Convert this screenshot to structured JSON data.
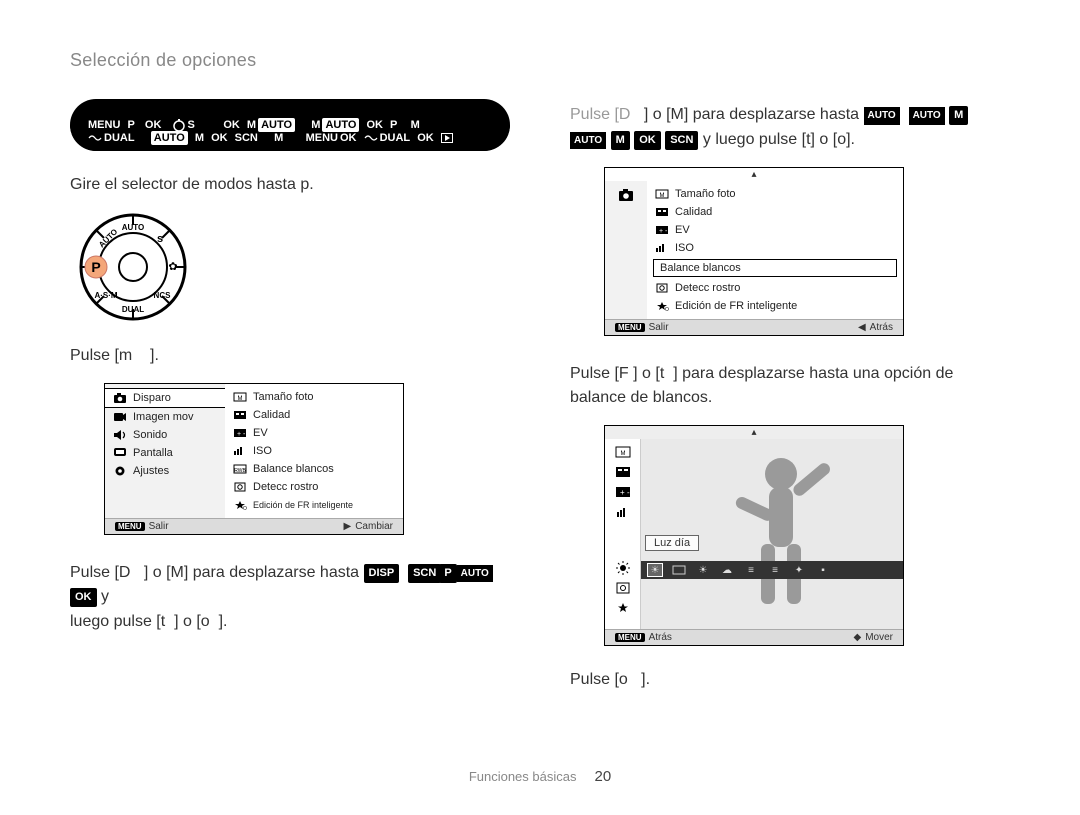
{
  "page_title": "Selección de opciones",
  "header_tokens_left": [
    "MENU",
    "P",
    "OK",
    "S",
    "OK",
    "M",
    "AUTO",
    "M",
    "AUTO",
    "OK",
    "P",
    "M",
    "DUAL",
    "AUTO",
    "M",
    "OK",
    "SCN",
    "M",
    "MENU",
    "OK",
    "DUAL",
    "OK"
  ],
  "left": {
    "step1": "Gire el selector de modos hasta",
    "step1_end": ".",
    "mode_letter": "p",
    "step2_pre": "Pulse [",
    "step2_letter": "m",
    "step2_post": "].",
    "menu1": {
      "left_items": [
        "Disparo",
        "Imagen mov",
        "Sonido",
        "Pantalla",
        "Ajustes"
      ],
      "left_selected_index": 0,
      "right_items": [
        "Tamaño foto",
        "Calidad",
        "EV",
        "ISO",
        "Balance blancos",
        "Detecc rostro",
        "Edición de FR inteligente"
      ],
      "footer_left_icon": "MENU",
      "footer_left": "Salir",
      "footer_right_icon": "▶",
      "footer_right": "Cambiar"
    },
    "step3_a": "Pulse [",
    "step3_b": "] o [",
    "step3_c": "] para desplazarse hasta ",
    "step3_d": " y",
    "step3_key1": "D",
    "step3_key2": "M",
    "step3_badges": [
      "DISP",
      "SCN",
      "P",
      "AUTO",
      "OK"
    ],
    "step3_line2_a": "luego pulse [",
    "step3_line2_b": "] o [",
    "step3_line2_c": "].",
    "step3_key3": "t",
    "step3_key4": "o"
  },
  "right": {
    "step4_a": "Pulse [",
    "step4_b": "] o [",
    "step4_c": "] para desplazarse hasta ",
    "step4_key1": "D",
    "step4_key2": "M",
    "step4_badges_top": [
      "AUTO",
      "AUTO",
      "M"
    ],
    "step4_line2_tokens": [
      "AUTO",
      "M",
      "OK",
      "SCN"
    ],
    "step4_line2_mid": " y luego pulse [",
    "step4_line2_keys": [
      "t",
      "o",
      "o"
    ],
    "step4_line2_end": "].",
    "menu2": {
      "right_items": [
        "Tamaño foto",
        "Calidad",
        "EV",
        "ISO",
        "Balance blancos",
        "Detecc rostro",
        "Edición de FR inteligente"
      ],
      "right_selected_index": 4,
      "footer_left_icon": "MENU",
      "footer_left": "Salir",
      "footer_right_icon": "◀",
      "footer_right": "Atrás"
    },
    "step5_a": "Pulse [",
    "step5_b": "] o [",
    "step5_c": "] para desplazarse hasta una opción de",
    "step5_key1": "F",
    "step5_key2": "t",
    "step5_line2": "balance de blancos.",
    "wb": {
      "selected_label": "Luz día",
      "footer_left_icon": "MENU",
      "footer_left": "Atrás",
      "footer_right_icon": "◆",
      "footer_right": "Mover"
    },
    "step6_a": "Pulse [",
    "step6_key": "o",
    "step6_b": "]."
  },
  "footer": {
    "section": "Funciones básicas",
    "page_number": "20"
  }
}
